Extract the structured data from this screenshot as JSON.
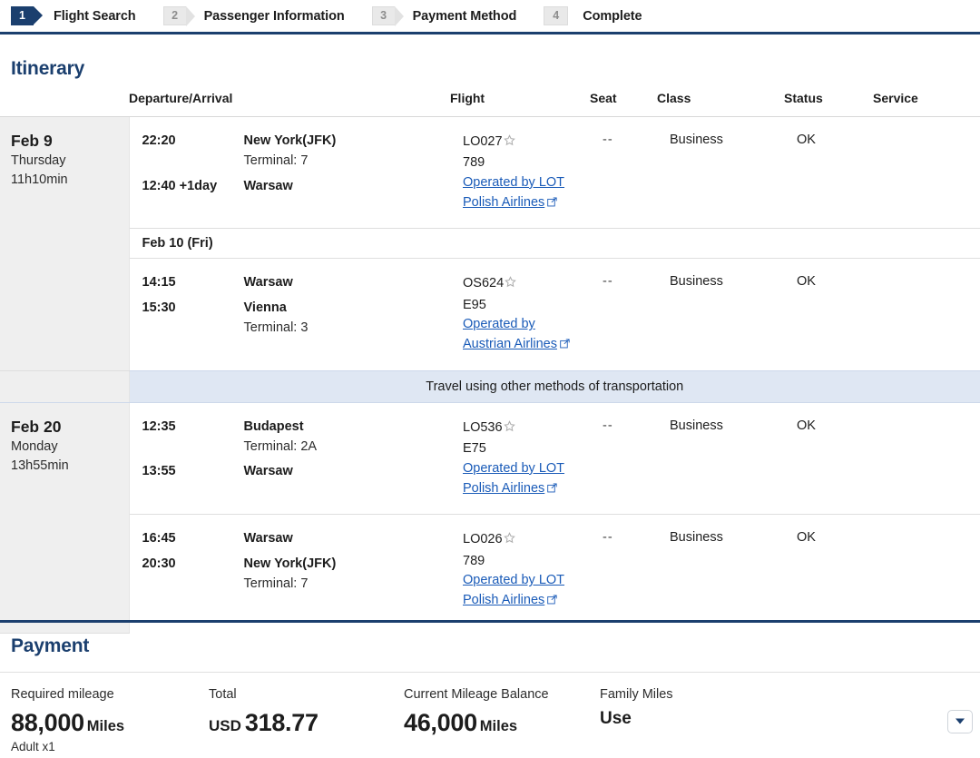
{
  "steps": [
    {
      "num": "1",
      "label": "Flight Search",
      "state": "active"
    },
    {
      "num": "2",
      "label": "Passenger Information",
      "state": "idle"
    },
    {
      "num": "3",
      "label": "Payment Method",
      "state": "idle"
    },
    {
      "num": "4",
      "label": "Complete",
      "state": "plain"
    }
  ],
  "itinerary": {
    "title": "Itinerary",
    "columns": {
      "departure_arrival": "Departure/Arrival",
      "flight": "Flight",
      "seat": "Seat",
      "class": "Class",
      "status": "Status",
      "service": "Service"
    },
    "groups": [
      {
        "date": {
          "day": "Feb 9",
          "weekday": "Thursday",
          "duration": "11h10min"
        },
        "segments": [
          {
            "dep_time": "22:20",
            "dep_place": "New York(JFK)",
            "dep_terminal": "Terminal: 7",
            "arr_time": "12:40 +1day",
            "arr_place": "Warsaw",
            "arr_terminal": "",
            "flight_no": "LO027",
            "equipment": "789",
            "operated_by": "Operated by LOT Polish Airlines",
            "seat": "--",
            "class": "Business",
            "status": "OK",
            "service": ""
          },
          {
            "divider": "Feb 10 (Fri)",
            "dep_time": "14:15",
            "dep_place": "Warsaw",
            "dep_terminal": "",
            "arr_time": "15:30",
            "arr_place": "Vienna",
            "arr_terminal": "Terminal: 3",
            "flight_no": "OS624",
            "equipment": "E95",
            "operated_by": "Operated by Austrian Airlines",
            "seat": "--",
            "class": "Business",
            "status": "OK",
            "service": ""
          }
        ]
      },
      {
        "banner": "Travel using other methods of transportation",
        "date": {
          "day": "Feb 20",
          "weekday": "Monday",
          "duration": "13h55min"
        },
        "segments": [
          {
            "dep_time": "12:35",
            "dep_place": "Budapest",
            "dep_terminal": "Terminal: 2A",
            "arr_time": "13:55",
            "arr_place": "Warsaw",
            "arr_terminal": "",
            "flight_no": "LO536",
            "equipment": "E75",
            "operated_by": "Operated by LOT Polish Airlines",
            "seat": "--",
            "class": "Business",
            "status": "OK",
            "service": ""
          },
          {
            "dep_time": "16:45",
            "dep_place": "Warsaw",
            "dep_terminal": "",
            "arr_time": "20:30",
            "arr_place": "New York(JFK)",
            "arr_terminal": "Terminal: 7",
            "flight_no": "LO026",
            "equipment": "789",
            "operated_by": "Operated by LOT Polish Airlines",
            "seat": "--",
            "class": "Business",
            "status": "OK",
            "service": ""
          }
        ]
      }
    ]
  },
  "payment": {
    "title": "Payment",
    "required_mileage": {
      "label": "Required mileage",
      "value": "88,000",
      "unit": "Miles",
      "sub": "Adult x1"
    },
    "total": {
      "label": "Total",
      "currency": "USD",
      "value": "318.77"
    },
    "current_balance": {
      "label": "Current Mileage Balance",
      "value": "46,000",
      "unit": "Miles"
    },
    "family_miles": {
      "label": "Family Miles",
      "value": "Use"
    }
  },
  "colors": {
    "navy": "#1b3f6e",
    "link": "#1a5bb8",
    "banner_bg": "#dfe7f3",
    "date_bg": "#efefef"
  }
}
